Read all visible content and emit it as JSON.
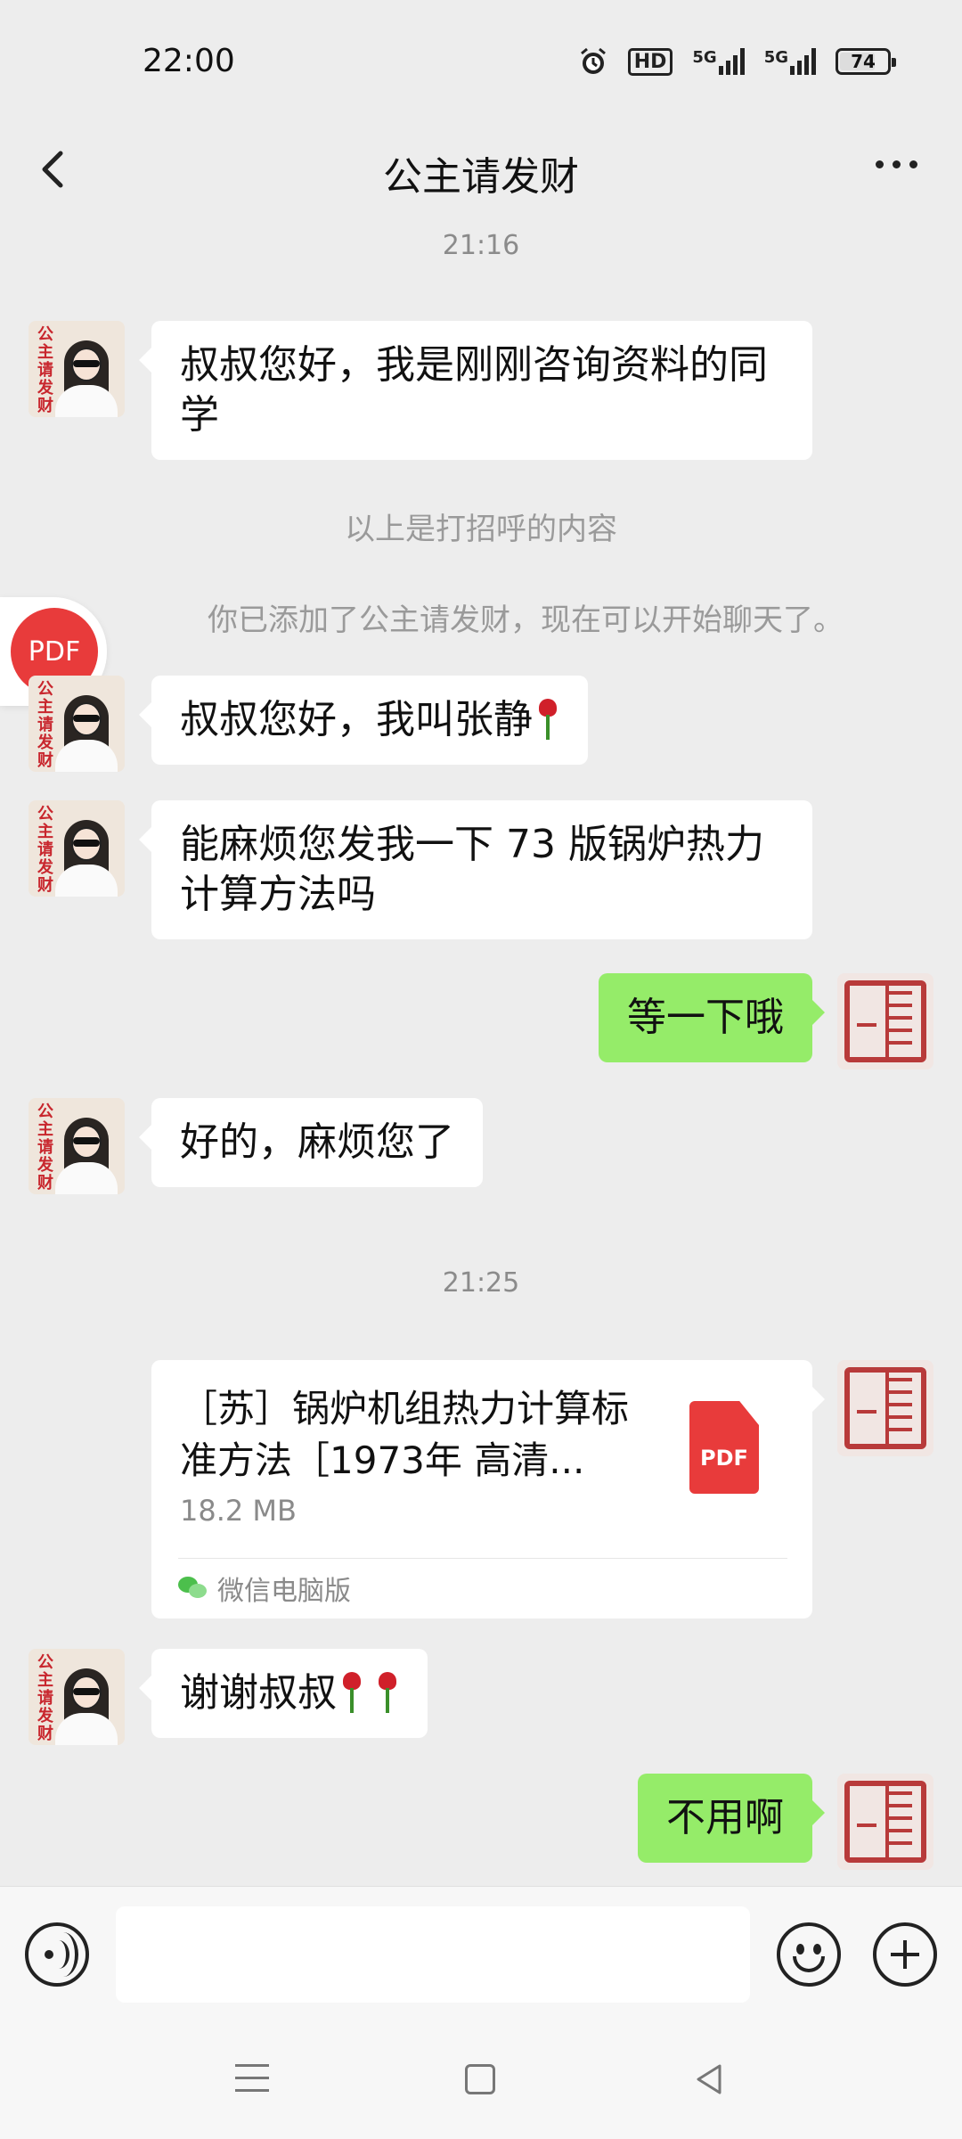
{
  "status_bar": {
    "time": "22:00",
    "hd_label": "HD",
    "net1": "5G",
    "net2": "5G",
    "battery": "74",
    "icons": [
      "alarm-icon",
      "hd-icon",
      "signal-icon",
      "signal-icon",
      "battery-icon"
    ]
  },
  "header": {
    "title": "公主请发财",
    "back_icon": "chevron-left-icon",
    "more_icon": "more-icon"
  },
  "messages": {
    "time1": "21:16",
    "m1": "叔叔您好，我是刚刚咨询资料的同学",
    "greeting_note": "以上是打招呼的内容",
    "added_note": "你已添加了公主请发财，现在可以开始聊天了。",
    "m2": "叔叔您好，我叫张静",
    "m3": "能麻烦您发我一下 73 版锅炉热力计算方法吗",
    "m4": "等一下哦",
    "m5": "好的，麻烦您了",
    "time2": "21:25",
    "file": {
      "name": "［苏］锅炉机组热力计算标准方法［1973年 高清...",
      "size": "18.2 MB",
      "type_label": "PDF",
      "source": "微信电脑版"
    },
    "m6": "谢谢叔叔",
    "m7": "不用啊"
  },
  "floating_badge": "PDF",
  "input": {
    "value": "",
    "placeholder": ""
  },
  "colors": {
    "background": "#ededed",
    "sent_bubble": "#95ec69",
    "received_bubble": "#ffffff",
    "pdf_red": "#e83b3b"
  }
}
